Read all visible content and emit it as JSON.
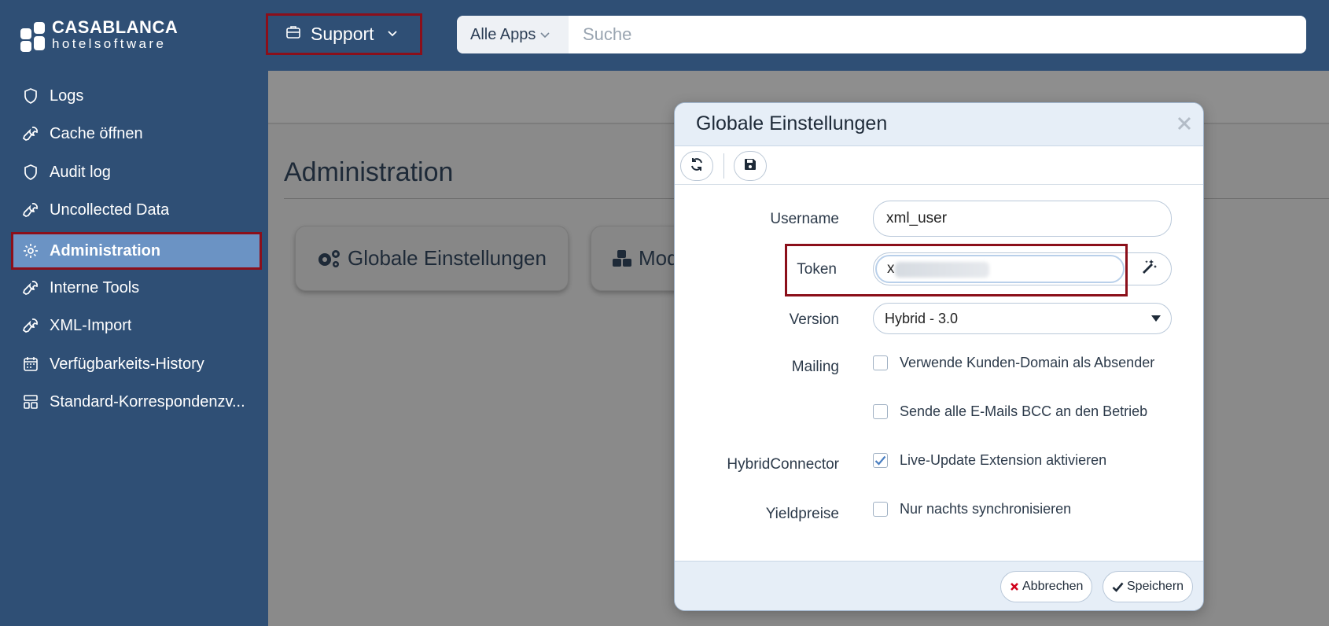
{
  "brand": {
    "title": "CASABLANCA",
    "subtitle": "hotelsoftware"
  },
  "header": {
    "app_switch_label": "Support",
    "search_scope_label": "Alle Apps",
    "search_placeholder": "Suche"
  },
  "sidebar": {
    "items": [
      {
        "label": "Logs",
        "icon": "shield-icon"
      },
      {
        "label": "Cache öffnen",
        "icon": "wrench-icon"
      },
      {
        "label": "Audit log",
        "icon": "shield-icon"
      },
      {
        "label": "Uncollected Data",
        "icon": "wrench-icon"
      },
      {
        "label": "Administration",
        "icon": "gear-icon",
        "active": true
      },
      {
        "label": "Interne Tools",
        "icon": "wrench-icon"
      },
      {
        "label": "XML-Import",
        "icon": "wrench-icon"
      },
      {
        "label": "Verfügbarkeits-History",
        "icon": "calendar-icon"
      },
      {
        "label": "Standard-Korrespondenzv...",
        "icon": "layout-icon"
      }
    ]
  },
  "main": {
    "title": "Administration",
    "tiles": [
      {
        "label": "Globale Einstellungen",
        "icon": "gears-icon"
      },
      {
        "label": "Mod",
        "icon": "cubes-icon"
      }
    ]
  },
  "dialog": {
    "title": "Globale Einstellungen",
    "toolbar": {
      "refresh_icon": "refresh-icon",
      "save_icon": "save-icon"
    },
    "fields": {
      "username_label": "Username",
      "username_value": "xml_user",
      "token_label": "Token",
      "token_value": "x",
      "version_label": "Version",
      "version_value": "Hybrid - 3.0",
      "mailing_label": "Mailing",
      "mailing_option_1": "Verwende Kunden-Domain als Absender",
      "mailing_option_1_checked": false,
      "mailing_option_2": "Sende alle E-Mails BCC an den Betrieb",
      "mailing_option_2_checked": false,
      "hybrid_label": "HybridConnector",
      "hybrid_option": "Live-Update Extension aktivieren",
      "hybrid_option_checked": true,
      "yield_label": "Yieldpreise",
      "yield_option": "Nur nachts synchronisieren",
      "yield_option_checked": false
    },
    "footer": {
      "cancel_label": "Abbrechen",
      "save_label": "Speichern"
    }
  },
  "colors": {
    "sidebar_bg": "#2f4f75",
    "active_item_bg": "#6b93c4",
    "highlight_outline": "#8b0f1a",
    "dialog_header_bg": "#e6eef7",
    "cancel_icon": "#d0021b"
  }
}
